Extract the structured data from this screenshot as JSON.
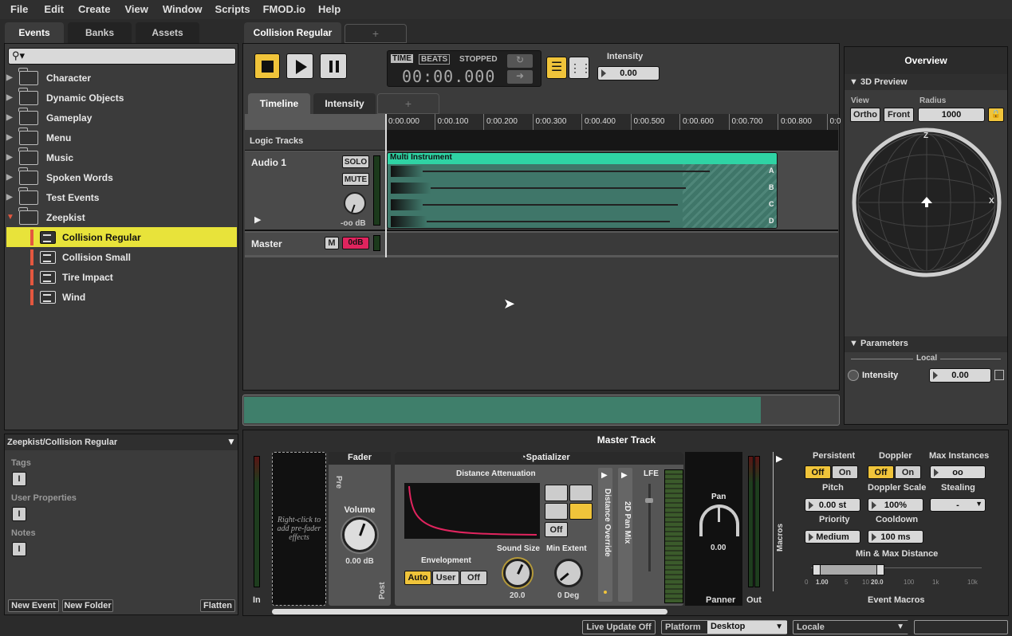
{
  "menu": [
    "File",
    "Edit",
    "Create",
    "View",
    "Window",
    "Scripts",
    "FMOD.io",
    "Help"
  ],
  "left_tabs": [
    "Events",
    "Banks",
    "Assets"
  ],
  "tree": [
    {
      "label": "Character",
      "type": "folder"
    },
    {
      "label": "Dynamic Objects",
      "type": "folder"
    },
    {
      "label": "Gameplay",
      "type": "folder"
    },
    {
      "label": "Menu",
      "type": "folder"
    },
    {
      "label": "Music",
      "type": "folder"
    },
    {
      "label": "Spoken Words",
      "type": "folder"
    },
    {
      "label": "Test Events",
      "type": "folder"
    },
    {
      "label": "Zeepkist",
      "type": "folder-open"
    },
    {
      "label": "Collision Regular",
      "type": "event",
      "selected": true
    },
    {
      "label": "Collision Small",
      "type": "event"
    },
    {
      "label": "Tire Impact",
      "type": "event"
    },
    {
      "label": "Wind",
      "type": "event"
    }
  ],
  "props": {
    "path": "Zeepkist/Collision Regular",
    "tags": "Tags",
    "user_props": "User Properties",
    "notes": "Notes"
  },
  "left_buttons": {
    "new_event": "New Event",
    "new_folder": "New Folder",
    "flatten": "Flatten"
  },
  "editor": {
    "tab": "Collision Regular",
    "add_tab": "+",
    "time_mode": "TIME",
    "beats_mode": "BEATS",
    "state": "STOPPED",
    "time": "00:00.000",
    "param_label": "Intensity",
    "param_value": "0.00"
  },
  "subtabs": [
    "Timeline",
    "Intensity",
    "+"
  ],
  "ruler": [
    "0:00.000",
    "0:00.100",
    "0:00.200",
    "0:00.300",
    "0:00.400",
    "0:00.500",
    "0:00.600",
    "0:00.700",
    "0:00.800",
    "0:0"
  ],
  "tracks": {
    "logic": "Logic Tracks",
    "audio1": "Audio 1",
    "solo": "SOLO",
    "mute": "MUTE",
    "audio_db": "-oo dB",
    "master": "Master",
    "master_m": "M",
    "master_db": "0dB",
    "instrument": "Multi Instrument",
    "lanes": [
      "A",
      "B",
      "C",
      "D"
    ]
  },
  "overview": {
    "title": "Overview",
    "preview": "3D Preview",
    "view_label": "View",
    "radius_label": "Radius",
    "ortho": "Ortho",
    "front": "Front",
    "radius": "1000",
    "axis_z": "Z",
    "axis_x": "X",
    "parameters": "Parameters",
    "local": "Local",
    "param_name": "Intensity",
    "param_value": "0.00"
  },
  "deck": {
    "title": "Master Track",
    "in": "In",
    "out": "Out",
    "prefader": "Right-click to add pre-fader effects",
    "fader": "Fader",
    "pre": "Pre",
    "post": "Post",
    "volume": "Volume",
    "volume_val": "0.00 dB",
    "spatializer": "Spatializer",
    "dist_att": "Distance Attenuation",
    "curve_off": "Off",
    "envelopment": "Envelopment",
    "env_opts": [
      "Auto",
      "User",
      "Off"
    ],
    "sound_size": "Sound Size",
    "sound_size_val": "20.0",
    "min_extent": "Min Extent",
    "min_extent_val": "0 Deg",
    "dist_override": "Distance Override",
    "pan_mix": "2D Pan Mix",
    "lfe": "LFE",
    "pan": "Pan",
    "pan_val": "0.00",
    "panner": "Panner",
    "macros": "Macros",
    "event_macros": "Event Macros",
    "persistent": "Persistent",
    "doppler": "Doppler",
    "max_instances": "Max Instances",
    "off": "Off",
    "on": "On",
    "max_val": "oo",
    "pitch": "Pitch",
    "pitch_val": "0.00 st",
    "doppler_scale": "Doppler Scale",
    "doppler_scale_val": "100%",
    "stealing": "Stealing",
    "stealing_val": "-",
    "priority": "Priority",
    "priority_val": "Medium",
    "cooldown": "Cooldown",
    "cooldown_val": "100 ms",
    "minmax": "Min & Max Distance",
    "minmax_ticks": [
      "0",
      "1.00",
      "5",
      "10",
      "20.0",
      "100",
      "1k",
      "10k"
    ]
  },
  "status": {
    "live_update": "Live Update Off",
    "platform_label": "Platform",
    "platform": "Desktop",
    "locale_label": "Locale"
  },
  "colors": {
    "accent": "#f0c43a",
    "instrument": "#2fd3a4",
    "selected_row": "#e8e33a",
    "red": "#e4573f"
  }
}
